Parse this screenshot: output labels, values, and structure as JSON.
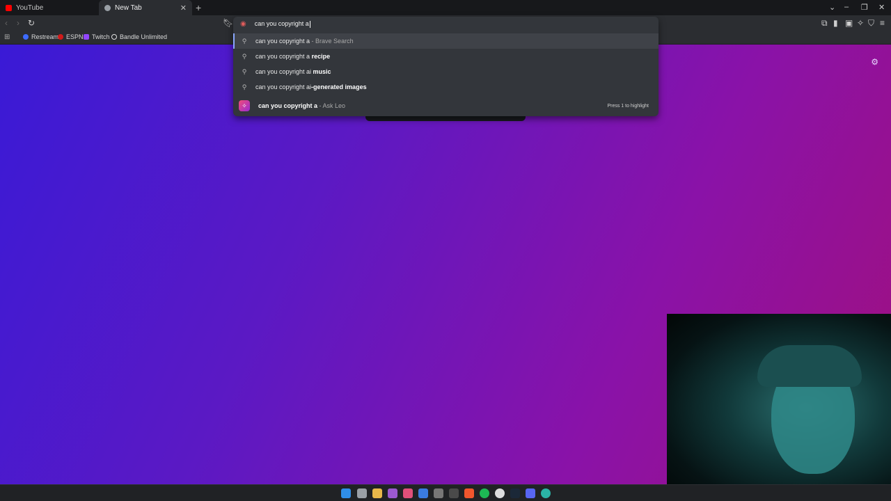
{
  "tabs": [
    {
      "title": "YouTube",
      "icon": "youtube-icon",
      "active": false
    },
    {
      "title": "New Tab",
      "icon": "brave-icon",
      "active": true
    }
  ],
  "omnibox": {
    "value": "can you copyright a",
    "suggestions": [
      {
        "typed": "can you copyright a",
        "completion": "",
        "suffix": " - Brave Search",
        "selected": true
      },
      {
        "typed": "can you copyright a ",
        "completion": "recipe",
        "suffix": "",
        "selected": false
      },
      {
        "typed": "can you copyright ai ",
        "completion": "music",
        "suffix": "",
        "selected": false
      },
      {
        "typed": "can you copyright ai",
        "completion": "-generated images",
        "suffix": "",
        "selected": false
      }
    ],
    "leo": {
      "typed": "can you copyright a",
      "suffix": " - Ask Leo",
      "hint": "Press 1 to highlight"
    }
  },
  "bookmarks": [
    {
      "label": "Restream",
      "color": "#3d6bff"
    },
    {
      "label": "ESPN",
      "color": "#d11a1a"
    },
    {
      "label": "Twitch",
      "color": "#9146ff"
    },
    {
      "label": "Bandle Unlimited",
      "color": "#e0e0e0"
    }
  ],
  "colors": {
    "gradient_start": "#3a1ad6",
    "gradient_end": "#a0107f",
    "leo_accent": "#f04c7a"
  },
  "taskbar_icons": [
    "windows-start-icon",
    "task-view-icon",
    "file-explorer-icon",
    "app-purple-icon",
    "app-pink-icon",
    "app-blue-icon",
    "app-grid-icon",
    "xbox-icon",
    "brave-icon",
    "spotify-icon",
    "github-icon",
    "steam-icon",
    "discord-icon",
    "app-teal-icon"
  ]
}
